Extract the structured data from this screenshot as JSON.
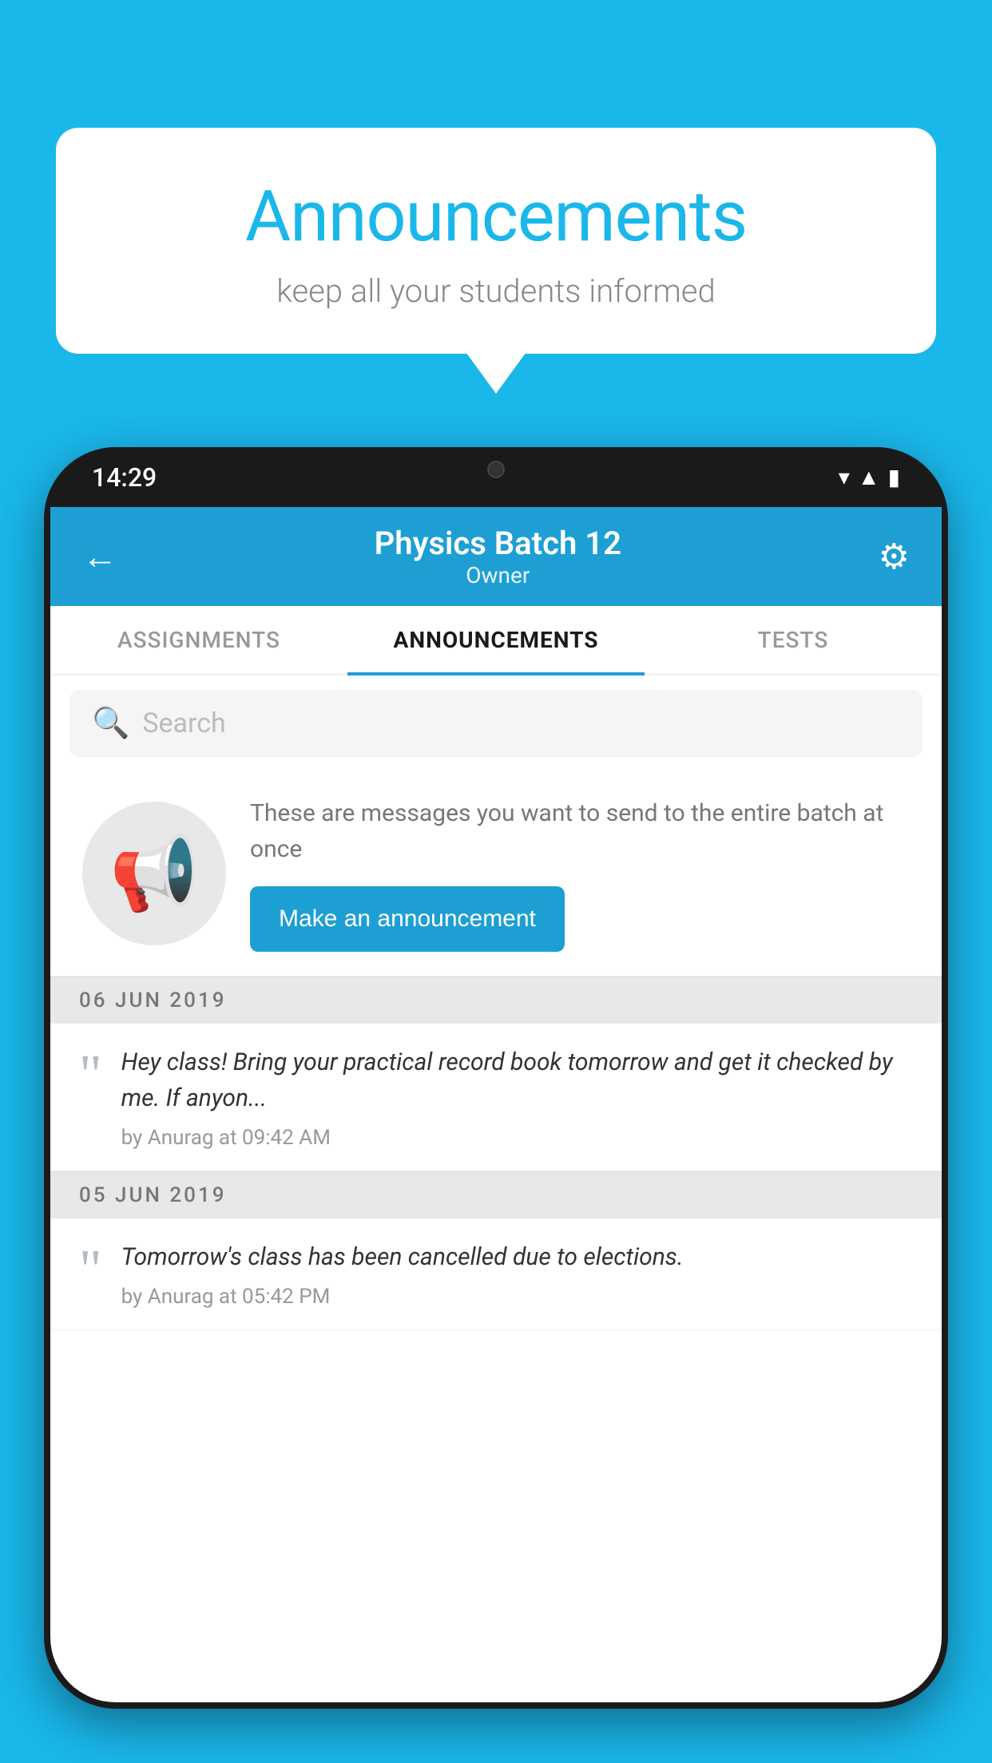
{
  "page": {
    "background_color": "#1ab7ea"
  },
  "speech_bubble": {
    "title": "Announcements",
    "subtitle": "keep all your students informed",
    "title_color": "#1ab7ea"
  },
  "phone": {
    "status_bar": {
      "time": "14:29"
    },
    "header": {
      "title": "Physics Batch 12",
      "subtitle": "Owner",
      "back_label": "←",
      "settings_label": "⚙"
    },
    "tabs": [
      {
        "label": "ASSIGNMENTS",
        "active": false
      },
      {
        "label": "ANNOUNCEMENTS",
        "active": true
      },
      {
        "label": "TESTS",
        "active": false
      }
    ],
    "search": {
      "placeholder": "Search"
    },
    "announcement_prompt": {
      "description": "These are messages you want to send to the entire batch at once",
      "button_label": "Make an announcement"
    },
    "announcements": [
      {
        "date": "06  JUN  2019",
        "text": "Hey class! Bring your practical record book tomorrow and get it checked by me. If anyon...",
        "meta": "by Anurag at 09:42 AM"
      },
      {
        "date": "05  JUN  2019",
        "text": "Tomorrow's class has been cancelled due to elections.",
        "meta": "by Anurag at 05:42 PM"
      }
    ]
  }
}
